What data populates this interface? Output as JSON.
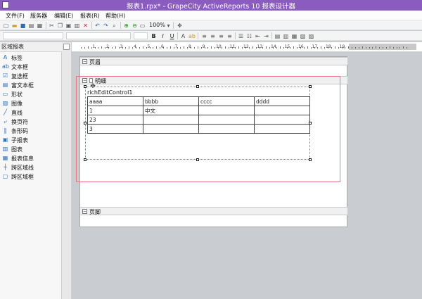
{
  "window": {
    "title": "报表1.rpx* - GrapeCity ActiveReports 10 报表设计器"
  },
  "menu": [
    {
      "label": "文件(F)"
    },
    {
      "label": "服务器"
    },
    {
      "label": "编辑(E)"
    },
    {
      "label": "报表(R)"
    },
    {
      "label": "帮助(H)"
    }
  ],
  "toolbar": {
    "zoom": "100%"
  },
  "toolbox": {
    "title": "区域报表",
    "items": [
      {
        "label": "标签",
        "icon": "label-icon"
      },
      {
        "label": "文本框",
        "icon": "textbox-icon"
      },
      {
        "label": "复选框",
        "icon": "checkbox-icon"
      },
      {
        "label": "富文本框",
        "icon": "richtext-icon"
      },
      {
        "label": "形状",
        "icon": "shape-icon"
      },
      {
        "label": "图像",
        "icon": "picture-icon"
      },
      {
        "label": "直线",
        "icon": "line-icon"
      },
      {
        "label": "换页符",
        "icon": "pagebreak-icon"
      },
      {
        "label": "条形码",
        "icon": "barcode-icon"
      },
      {
        "label": "子报表",
        "icon": "subreport-icon"
      },
      {
        "label": "图表",
        "icon": "chart-icon"
      },
      {
        "label": "报表信息",
        "icon": "reportinfo-icon"
      },
      {
        "label": "跨区域线",
        "icon": "crosssection-line-icon"
      },
      {
        "label": "跨区域框",
        "icon": "crosssection-box-icon"
      }
    ]
  },
  "ruler": {
    "labels": [
      "1",
      "2",
      "3",
      "4",
      "5",
      "6",
      "7",
      "8",
      "9",
      "10",
      "11",
      "12",
      "13",
      "14",
      "15",
      "16",
      "17",
      "18",
      "19"
    ]
  },
  "report": {
    "bands": {
      "page_header": "页眉",
      "detail": "明细",
      "page_footer": "页脚"
    },
    "control_name": "richEditControl1",
    "table": [
      [
        "aaaa",
        "bbbb",
        "cccc",
        "dddd"
      ],
      [
        "1",
        "中文",
        "",
        ""
      ],
      [
        "23",
        "",
        "",
        ""
      ],
      [
        "3",
        "",
        "",
        ""
      ]
    ]
  }
}
